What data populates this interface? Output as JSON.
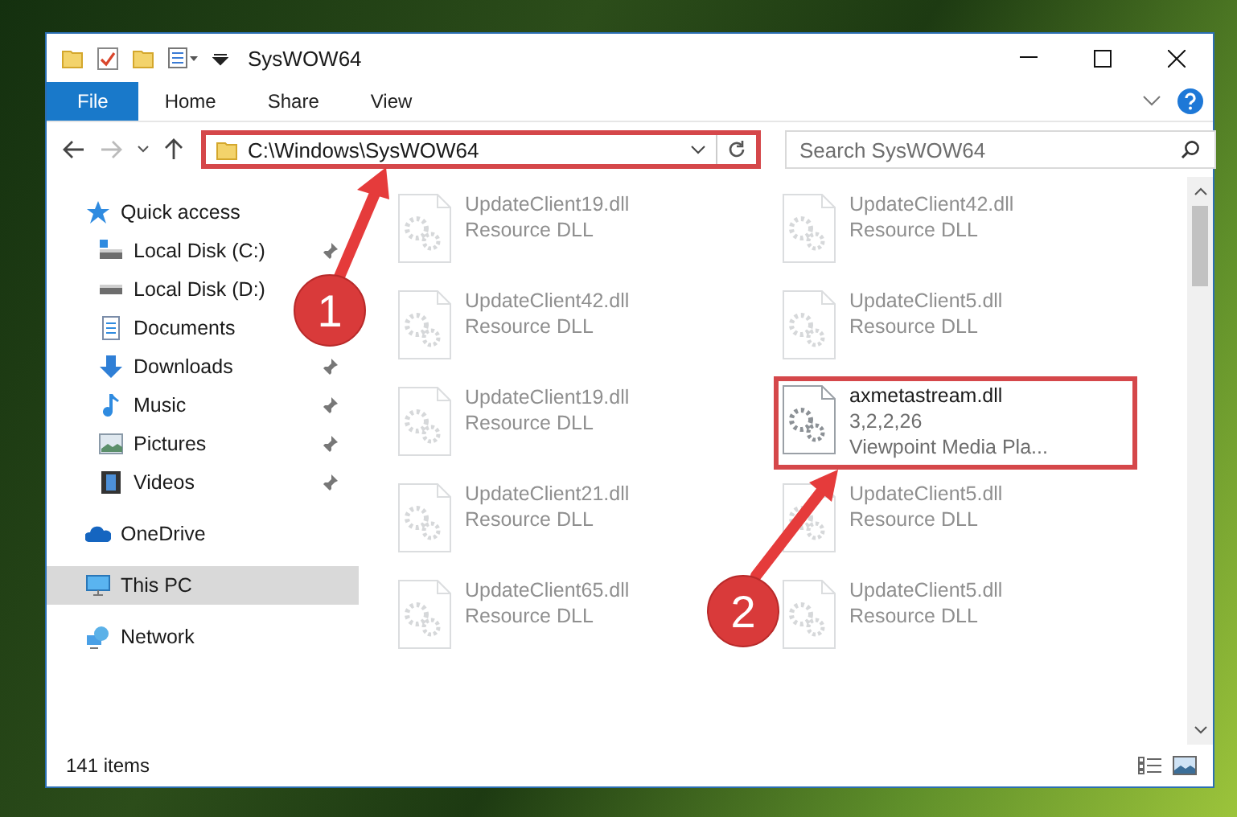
{
  "window": {
    "title": "SysWOW64"
  },
  "ribbon_tabs": [
    {
      "label": "File",
      "kind": "file",
      "selected": false
    },
    {
      "label": "Home",
      "kind": "tab",
      "selected": false
    },
    {
      "label": "Share",
      "kind": "tab",
      "selected": false
    },
    {
      "label": "View",
      "kind": "tab",
      "selected": false
    }
  ],
  "address": {
    "path": "C:\\Windows\\SysWOW64",
    "highlighted": true
  },
  "search": {
    "placeholder": "Search SysWOW64"
  },
  "nav": [
    {
      "label": "Quick access",
      "selected": false,
      "children": [
        {
          "label": "Local Disk (C:)",
          "pinned": true,
          "selected": false
        },
        {
          "label": "Local Disk (D:)",
          "selected": false
        },
        {
          "label": "Documents",
          "selected": false
        },
        {
          "label": "Downloads",
          "pinned": true,
          "selected": false
        },
        {
          "label": "Music",
          "pinned": true,
          "selected": false
        },
        {
          "label": "Pictures",
          "pinned": true,
          "selected": false
        },
        {
          "label": "Videos",
          "pinned": true,
          "selected": false
        }
      ]
    },
    {
      "label": "OneDrive",
      "selected": false
    },
    {
      "label": "This PC",
      "selected": true
    },
    {
      "label": "Network",
      "selected": false
    }
  ],
  "files": [
    {
      "name": "UpdateClient19.dll",
      "details": [
        "Resource DLL"
      ],
      "dimmed": true,
      "highlighted": false
    },
    {
      "name": "UpdateClient42.dll",
      "details": [
        "Resource DLL"
      ],
      "dimmed": true,
      "highlighted": false
    },
    {
      "name": "UpdateClient42.dll",
      "details": [
        "Resource DLL"
      ],
      "dimmed": true,
      "highlighted": false
    },
    {
      "name": "UpdateClient5.dll",
      "details": [
        "Resource DLL"
      ],
      "dimmed": true,
      "highlighted": false
    },
    {
      "name": "UpdateClient19.dll",
      "details": [
        "Resource DLL"
      ],
      "dimmed": true,
      "highlighted": false
    },
    {
      "name": "axmetastream.dll",
      "details": [
        "3,2,2,26",
        "Viewpoint Media Pla..."
      ],
      "dimmed": false,
      "highlighted": true
    },
    {
      "name": "UpdateClient21.dll",
      "details": [
        "Resource DLL"
      ],
      "dimmed": true,
      "highlighted": false
    },
    {
      "name": "UpdateClient5.dll",
      "details": [
        "Resource DLL"
      ],
      "dimmed": true,
      "highlighted": false
    },
    {
      "name": "UpdateClient65.dll",
      "details": [
        "Resource DLL"
      ],
      "dimmed": true,
      "highlighted": false
    },
    {
      "name": "UpdateClient5.dll",
      "details": [
        "Resource DLL"
      ],
      "dimmed": true,
      "highlighted": false
    }
  ],
  "status_bar": {
    "text": "141 items"
  },
  "annotations": [
    {
      "label": "1"
    },
    {
      "label": "2"
    }
  ]
}
